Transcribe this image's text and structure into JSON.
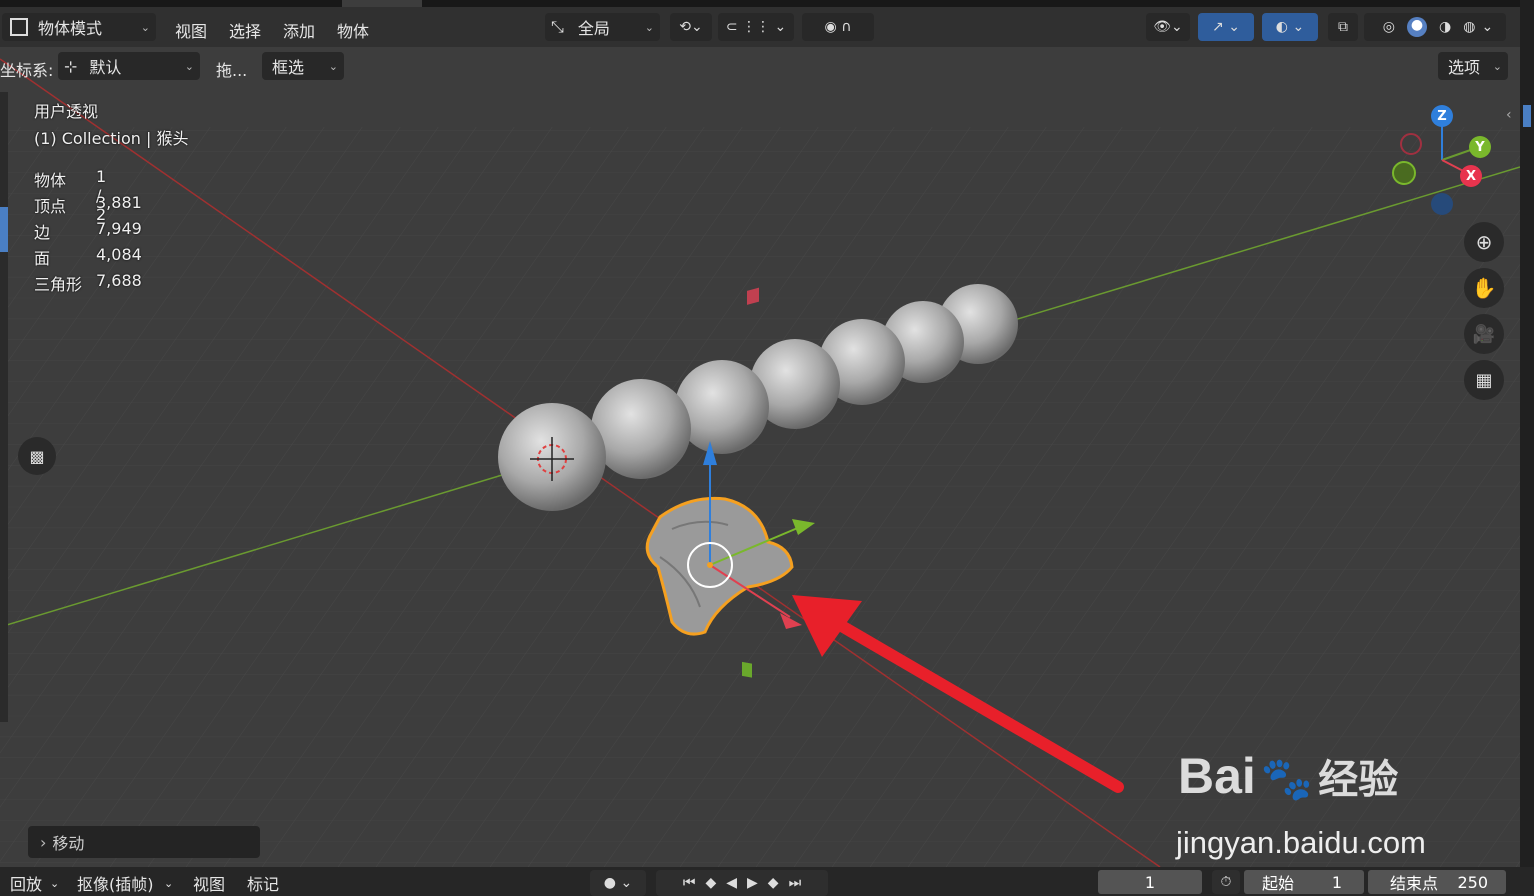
{
  "header": {
    "mode_label": "物体模式",
    "menus": [
      "视图",
      "选择",
      "添加",
      "物体"
    ],
    "transform_orientation": "全局",
    "options_label": "选项"
  },
  "subheader": {
    "coord_label": "坐标系:",
    "coord_value": "默认",
    "drag_label": "拖...",
    "select_mode": "框选"
  },
  "overlay": {
    "view_name": "用户透视",
    "collection": "(1) Collection | 猴头",
    "stats": [
      {
        "label": "物体",
        "value": "1 / 2"
      },
      {
        "label": "顶点",
        "value": "3,881"
      },
      {
        "label": "边",
        "value": "7,949"
      },
      {
        "label": "面",
        "value": "4,084"
      },
      {
        "label": "三角形",
        "value": "7,688"
      }
    ]
  },
  "gizmo": {
    "z": "Z",
    "y": "Y",
    "x": "X"
  },
  "last_operator": "移动",
  "timeline": {
    "playback": "回放",
    "keying": "抠像(插帧)",
    "view": "视图",
    "marker": "标记",
    "current_frame": "1",
    "start_label": "起始",
    "start_value": "1",
    "end_label": "结束点",
    "end_value": "250"
  },
  "watermark": {
    "brand": "Bai",
    "brand_cn": "经验",
    "url": "jingyan.baidu.com"
  },
  "colors": {
    "x_axis": "#a03030",
    "y_axis": "#6a9a30",
    "selection": "#f5a020",
    "arrow": "#e8202a",
    "gizmo_blue": "#2f7fdc"
  }
}
